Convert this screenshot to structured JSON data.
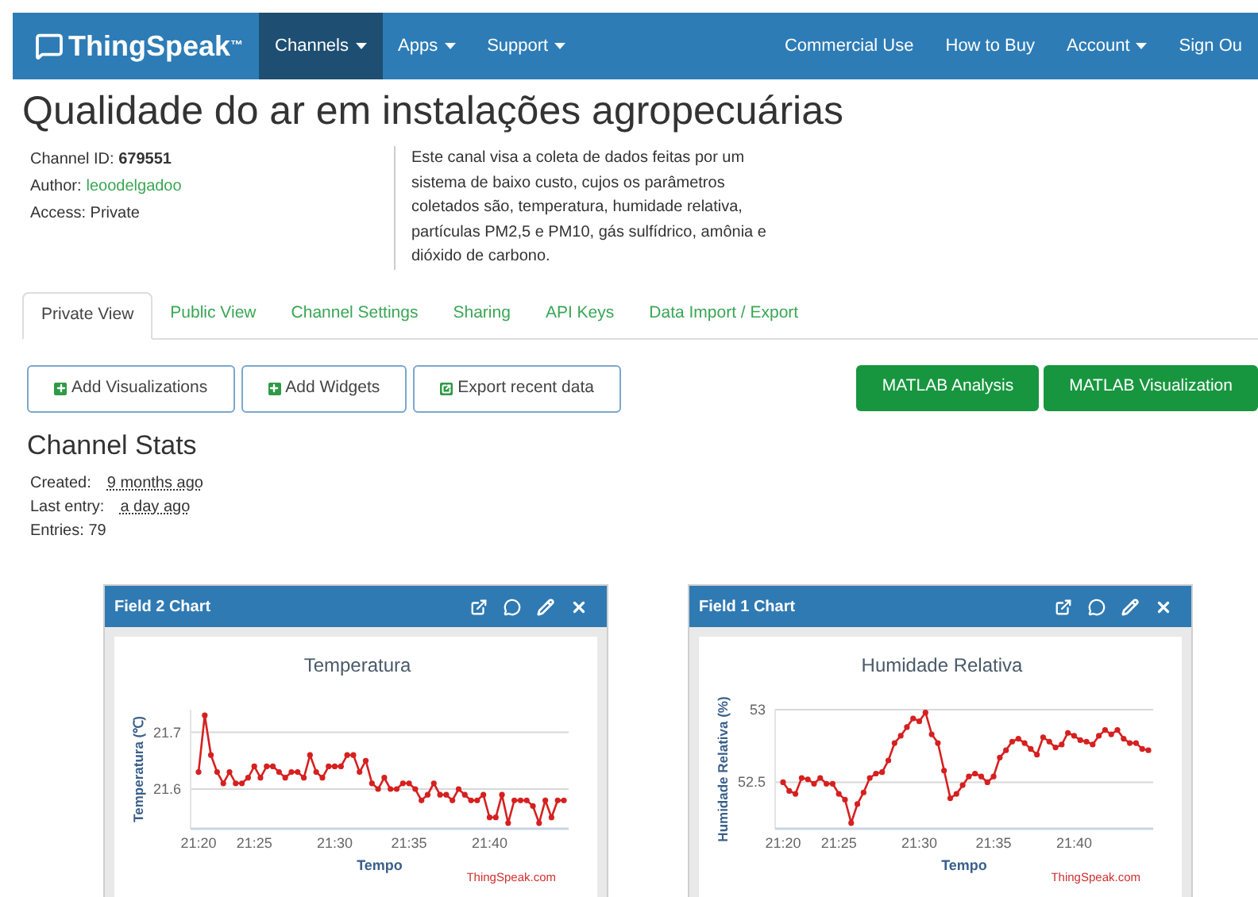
{
  "navbar": {
    "brand": "ThingSpeak",
    "trademark": "™",
    "left_items": [
      {
        "label": "Channels",
        "dropdown": true,
        "selected": true
      },
      {
        "label": "Apps",
        "dropdown": true,
        "selected": false
      },
      {
        "label": "Support",
        "dropdown": true,
        "selected": false
      }
    ],
    "right_items": [
      {
        "label": "Commercial Use",
        "dropdown": false
      },
      {
        "label": "How to Buy",
        "dropdown": false
      },
      {
        "label": "Account",
        "dropdown": true
      },
      {
        "label": "Sign Ou",
        "dropdown": false
      }
    ]
  },
  "channel": {
    "title": "Qualidade do ar em instalações agropecuárias",
    "id_label": "Channel ID:",
    "id": "679551",
    "author_label": "Author:",
    "author": "leoodelgadoo",
    "access_label": "Access:",
    "access": "Private",
    "description": "Este canal visa a coleta de dados feitas por um sistema de baixo custo, cujos os parâmetros coletados são, temperatura, humidade relativa, partículas PM2,5 e PM10, gás sulfídrico, amônia e dióxido de carbono."
  },
  "tabs": [
    {
      "label": "Private View",
      "selected": true
    },
    {
      "label": "Public View",
      "selected": false
    },
    {
      "label": "Channel Settings",
      "selected": false
    },
    {
      "label": "Sharing",
      "selected": false
    },
    {
      "label": "API Keys",
      "selected": false
    },
    {
      "label": "Data Import / Export",
      "selected": false
    }
  ],
  "actions": [
    {
      "label": "Add Visualizations",
      "kind": "plus"
    },
    {
      "label": "Add Widgets",
      "kind": "plus"
    },
    {
      "label": "Export recent data",
      "kind": "export"
    }
  ],
  "matlab_buttons": [
    "MATLAB Analysis",
    "MATLAB Visualization"
  ],
  "stats": {
    "heading": "Channel Stats",
    "created_label": "Created:",
    "created": "9 months ago",
    "last_entry_label": "Last entry:",
    "last_entry": "a day ago",
    "entries_label": "Entries:",
    "entries": "79"
  },
  "panels": [
    {
      "title": "Field 2 Chart",
      "credit": "ThingSpeak.com",
      "chart_data": {
        "type": "line",
        "title": "Temperatura",
        "xlabel": "Tempo",
        "ylabel": "Temperatura (℃)",
        "ylim": [
          21.53,
          21.74
        ],
        "yticks": [
          21.6,
          21.7
        ],
        "categories": [
          "21:20",
          null,
          null,
          null,
          null,
          null,
          null,
          null,
          null,
          "21:25",
          null,
          null,
          null,
          null,
          null,
          null,
          null,
          null,
          null,
          null,
          null,
          null,
          "21:30",
          null,
          null,
          null,
          null,
          null,
          null,
          null,
          null,
          null,
          null,
          null,
          "21:35",
          null,
          null,
          null,
          null,
          null,
          null,
          null,
          null,
          null,
          null,
          null,
          null,
          "21:40",
          null,
          null,
          null,
          null,
          null,
          null,
          null,
          null,
          null,
          null,
          null,
          null
        ],
        "series": [
          {
            "color": "#d62020",
            "marker": "circle",
            "values": [
              21.63,
              21.73,
              21.66,
              21.63,
              21.61,
              21.63,
              21.61,
              21.61,
              21.62,
              21.64,
              21.62,
              21.64,
              21.64,
              21.63,
              21.62,
              21.63,
              21.63,
              21.62,
              21.66,
              21.63,
              21.62,
              21.64,
              21.64,
              21.64,
              21.66,
              21.66,
              21.63,
              21.65,
              21.61,
              21.6,
              21.62,
              21.6,
              21.6,
              21.61,
              21.61,
              21.6,
              21.58,
              21.59,
              21.61,
              21.59,
              21.59,
              21.58,
              21.6,
              21.59,
              21.58,
              21.58,
              21.59,
              21.55,
              21.55,
              21.59,
              21.54,
              21.58,
              21.58,
              21.58,
              21.57,
              21.54,
              21.58,
              21.55,
              21.58,
              21.58
            ]
          }
        ]
      }
    },
    {
      "title": "Field 1 Chart",
      "credit": "ThingSpeak.com",
      "chart_data": {
        "type": "line",
        "title": "Humidade Relativa",
        "xlabel": "Tempo",
        "ylabel": "Humidade Relativa (%)",
        "ylim": [
          52.18,
          53
        ],
        "yticks": [
          52.5,
          53
        ],
        "categories": [
          "21:20",
          null,
          null,
          null,
          null,
          null,
          null,
          null,
          null,
          "21:25",
          null,
          null,
          null,
          null,
          null,
          null,
          null,
          null,
          null,
          null,
          null,
          null,
          "21:30",
          null,
          null,
          null,
          null,
          null,
          null,
          null,
          null,
          null,
          null,
          null,
          "21:35",
          null,
          null,
          null,
          null,
          null,
          null,
          null,
          null,
          null,
          null,
          null,
          null,
          "21:40",
          null,
          null,
          null,
          null,
          null,
          null,
          null,
          null,
          null,
          null,
          null,
          null
        ],
        "series": [
          {
            "color": "#d62020",
            "marker": "circle",
            "values": [
              52.5,
              52.44,
              52.42,
              52.53,
              52.52,
              52.49,
              52.53,
              52.49,
              52.49,
              52.42,
              52.38,
              52.22,
              52.35,
              52.43,
              52.53,
              52.56,
              52.57,
              52.65,
              52.77,
              52.82,
              52.88,
              52.94,
              52.92,
              52.98,
              52.83,
              52.77,
              52.58,
              52.39,
              52.42,
              52.48,
              52.54,
              52.56,
              52.54,
              52.5,
              52.54,
              52.67,
              52.72,
              52.78,
              52.8,
              52.77,
              52.73,
              52.69,
              52.81,
              52.78,
              52.74,
              52.76,
              52.84,
              52.82,
              52.79,
              52.78,
              52.76,
              52.82,
              52.86,
              52.83,
              52.86,
              52.8,
              52.77,
              52.77,
              52.73,
              52.72
            ]
          }
        ]
      }
    }
  ]
}
